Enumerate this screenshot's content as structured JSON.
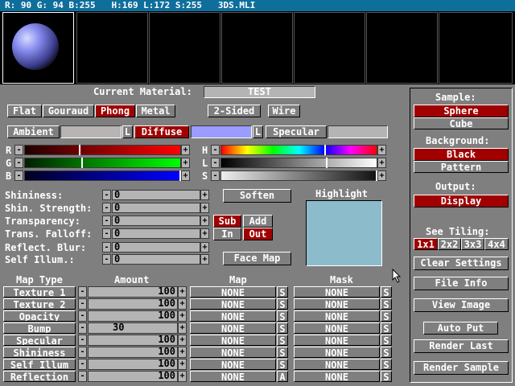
{
  "status": "R: 90 G: 94 B:255   H:169 L:172 S:255   3DS.MLI",
  "material": {
    "label": "Current Material:",
    "name": "TEST"
  },
  "shading": [
    "Flat",
    "Gouraud",
    "Phong",
    "Metal"
  ],
  "two_sided": "2-Sided",
  "wire": "Wire",
  "color_tabs": {
    "ambient": "Ambient",
    "diffuse": "Diffuse",
    "specular": "Specular",
    "lock": "L"
  },
  "rgb_labels": [
    "R",
    "G",
    "B"
  ],
  "hls_labels": [
    "H",
    "L",
    "S"
  ],
  "minus": "-",
  "plus": "+",
  "props": [
    {
      "label": "Shininess:",
      "value": "0"
    },
    {
      "label": "Shin. Strength:",
      "value": "0"
    },
    {
      "label": "Transparency:",
      "value": "0"
    },
    {
      "label": "Trans. Falloff:",
      "value": "0"
    },
    {
      "label": "Reflect. Blur:",
      "value": "0"
    },
    {
      "label": "Self Illum.:",
      "value": "0"
    }
  ],
  "soften": "Soften",
  "highlight": "Highlight",
  "sub": "Sub",
  "add": "Add",
  "in": "In",
  "out": "Out",
  "face_map": "Face Map",
  "map_headers": {
    "type": "Map Type",
    "amount": "Amount",
    "map": "Map",
    "mask": "Mask"
  },
  "maps": [
    {
      "type": "Texture 1",
      "amount": "100",
      "map": "NONE",
      "s": "S",
      "mask": "NONE",
      "ms": "S"
    },
    {
      "type": "Texture 2",
      "amount": "100",
      "map": "NONE",
      "s": "S",
      "mask": "NONE",
      "ms": "S"
    },
    {
      "type": "Opacity",
      "amount": "100",
      "map": "NONE",
      "s": "S",
      "mask": "NONE",
      "ms": "S"
    },
    {
      "type": "Bump",
      "amount": "30",
      "map": "NONE",
      "s": "S",
      "mask": "NONE",
      "ms": "S"
    },
    {
      "type": "Specular",
      "amount": "100",
      "map": "NONE",
      "s": "S",
      "mask": "NONE",
      "ms": "S"
    },
    {
      "type": "Shininess",
      "amount": "100",
      "map": "NONE",
      "s": "S",
      "mask": "NONE",
      "ms": "S"
    },
    {
      "type": "Self Illum",
      "amount": "100",
      "map": "NONE",
      "s": "S",
      "mask": "NONE",
      "ms": "S"
    },
    {
      "type": "Reflection",
      "amount": "100",
      "map": "NONE",
      "s": "A",
      "mask": "NONE",
      "ms": "S"
    }
  ],
  "right": {
    "sample_label": "Sample:",
    "sphere": "Sphere",
    "cube": "Cube",
    "background_label": "Background:",
    "black": "Black",
    "pattern": "Pattern",
    "output_label": "Output:",
    "display": "Display",
    "tiling_label": "See Tiling:",
    "tiling": [
      "1x1",
      "2x2",
      "3x3",
      "4x4"
    ],
    "clear": "Clear Settings",
    "file_info": "File Info",
    "view_image": "View Image",
    "auto_put": "Auto Put",
    "render_last": "Render Last",
    "render_sample": "Render Sample"
  },
  "colors": {
    "accent": "#a00000",
    "status": "#0e6e9c",
    "diffuse": "#9a9cff",
    "highlight": "#8cbccc"
  }
}
